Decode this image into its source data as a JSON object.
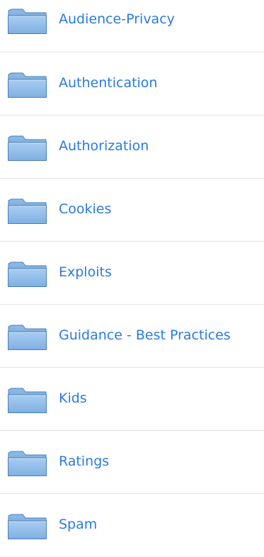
{
  "folders": [
    {
      "label": "Audience-Privacy",
      "icon": "folder-icon"
    },
    {
      "label": "Authentication",
      "icon": "folder-icon"
    },
    {
      "label": "Authorization",
      "icon": "folder-icon"
    },
    {
      "label": "Cookies",
      "icon": "folder-icon"
    },
    {
      "label": "Exploits",
      "icon": "folder-icon"
    },
    {
      "label": "Guidance - Best Practices",
      "icon": "folder-icon"
    },
    {
      "label": "Kids",
      "icon": "folder-icon"
    },
    {
      "label": "Ratings",
      "icon": "folder-icon"
    },
    {
      "label": "Spam",
      "icon": "folder-icon"
    }
  ],
  "colors": {
    "link": "#2a7ae2",
    "divider": "#e3e3e3",
    "folder_fill": "#7fb0e3",
    "folder_edge": "#4a7fb8"
  }
}
